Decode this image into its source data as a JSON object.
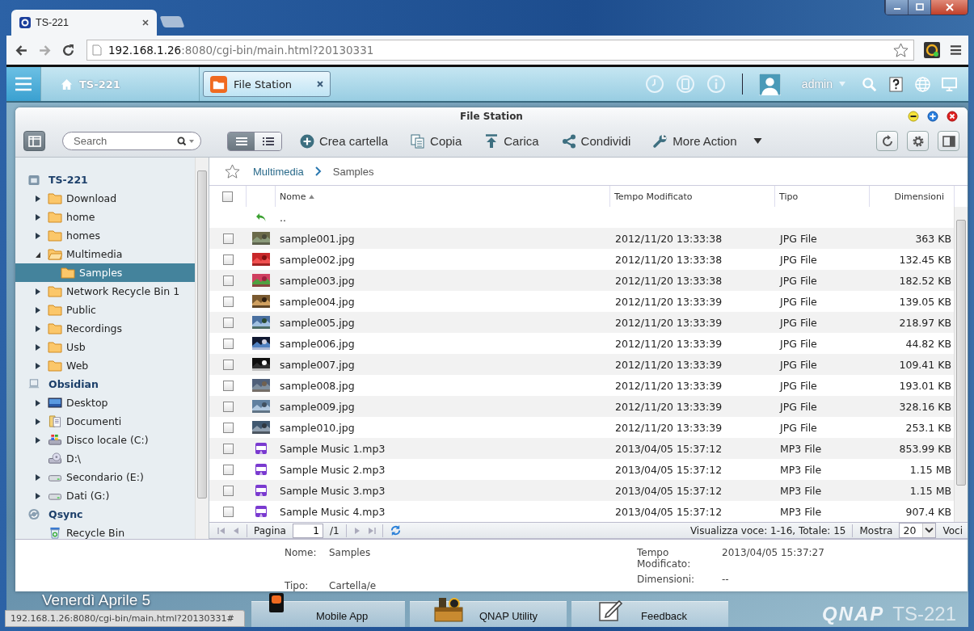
{
  "browser": {
    "tabs": [
      {
        "title": "TS-221",
        "selected": true
      }
    ],
    "url_host": "192.168.1.26",
    "url_rest": ":8080/cgi-bin/main.html?20130331"
  },
  "topbar": {
    "home_label": "TS-221",
    "app_tab": "File Station",
    "user": "admin"
  },
  "window": {
    "title": "File Station"
  },
  "toolbar": {
    "search_placeholder": "Search",
    "view_modes": [
      {
        "kind": "details",
        "selected": true
      },
      {
        "kind": "list",
        "selected": false
      }
    ],
    "actions": [
      {
        "label": "Crea cartella",
        "kind": "create"
      },
      {
        "label": "Copia",
        "kind": "copy"
      },
      {
        "label": "Carica",
        "kind": "upload"
      },
      {
        "label": "Condividi",
        "kind": "share"
      },
      {
        "label": "More Action",
        "kind": "more"
      }
    ]
  },
  "sidebar": {
    "tree": [
      {
        "label": "TS-221",
        "kind": "nas",
        "selected": false,
        "children": [
          {
            "label": "Download",
            "kind": "folder",
            "expanded": false,
            "selected": false
          },
          {
            "label": "home",
            "kind": "folder",
            "expanded": false,
            "selected": false
          },
          {
            "label": "homes",
            "kind": "folder",
            "expanded": false,
            "selected": false
          },
          {
            "label": "Multimedia",
            "kind": "folder",
            "expanded": true,
            "selected": false,
            "children": [
              {
                "label": "Samples",
                "kind": "folder",
                "selected": true
              }
            ]
          },
          {
            "label": "Network Recycle Bin 1",
            "kind": "folder",
            "expanded": false,
            "selected": false
          },
          {
            "label": "Public",
            "kind": "folder",
            "expanded": false,
            "selected": false
          },
          {
            "label": "Recordings",
            "kind": "folder",
            "expanded": false,
            "selected": false
          },
          {
            "label": "Usb",
            "kind": "folder",
            "expanded": false,
            "selected": false
          },
          {
            "label": "Web",
            "kind": "folder",
            "expanded": false,
            "selected": false
          }
        ]
      },
      {
        "label": "Obsidian",
        "kind": "computer",
        "selected": false,
        "children": [
          {
            "label": "Desktop",
            "kind": "desktop",
            "expanded": false,
            "selected": false
          },
          {
            "label": "Documenti",
            "kind": "documents",
            "expanded": false,
            "selected": false
          },
          {
            "label": "Disco locale (C:)",
            "kind": "system-drive",
            "expanded": false,
            "selected": false
          },
          {
            "label": "D:\\",
            "kind": "optical-drive",
            "selected": false
          },
          {
            "label": "Secondario (E:)",
            "kind": "drive",
            "expanded": false,
            "selected": false
          },
          {
            "label": "Dati (G:)",
            "kind": "drive",
            "expanded": false,
            "selected": false
          }
        ]
      },
      {
        "label": "Qsync",
        "kind": "sync",
        "selected": false,
        "children": [
          {
            "label": "Recycle Bin",
            "kind": "recycle",
            "selected": false
          }
        ]
      }
    ]
  },
  "breadcrumb": {
    "starred": false,
    "items": [
      "Multimedia",
      "Samples"
    ]
  },
  "table": {
    "all_checked": false,
    "columns": [
      {
        "label": "Nome",
        "sorted": true
      },
      {
        "label": "Tempo Modificato",
        "sorted": false
      },
      {
        "label": "Tipo",
        "sorted": false
      },
      {
        "label": "Dimensioni",
        "sorted": false
      }
    ],
    "parent_row": "..",
    "rows": [
      {
        "name": "sample001.jpg",
        "modified": "2012/11/20 13:33:38",
        "type": "JPG File",
        "size": "363 KB",
        "checked": false
      },
      {
        "name": "sample002.jpg",
        "modified": "2012/11/20 13:33:38",
        "type": "JPG File",
        "size": "132.45 KB",
        "checked": false
      },
      {
        "name": "sample003.jpg",
        "modified": "2012/11/20 13:33:38",
        "type": "JPG File",
        "size": "182.52 KB",
        "checked": false
      },
      {
        "name": "sample004.jpg",
        "modified": "2012/11/20 13:33:39",
        "type": "JPG File",
        "size": "139.05 KB",
        "checked": false
      },
      {
        "name": "sample005.jpg",
        "modified": "2012/11/20 13:33:39",
        "type": "JPG File",
        "size": "218.97 KB",
        "checked": false
      },
      {
        "name": "sample006.jpg",
        "modified": "2012/11/20 13:33:39",
        "type": "JPG File",
        "size": "44.82 KB",
        "checked": false
      },
      {
        "name": "sample007.jpg",
        "modified": "2012/11/20 13:33:39",
        "type": "JPG File",
        "size": "109.41 KB",
        "checked": false
      },
      {
        "name": "sample008.jpg",
        "modified": "2012/11/20 13:33:39",
        "type": "JPG File",
        "size": "193.01 KB",
        "checked": false
      },
      {
        "name": "sample009.jpg",
        "modified": "2012/11/20 13:33:39",
        "type": "JPG File",
        "size": "328.16 KB",
        "checked": false
      },
      {
        "name": "sample010.jpg",
        "modified": "2012/11/20 13:33:39",
        "type": "JPG File",
        "size": "253.1 KB",
        "checked": false
      },
      {
        "name": "Sample Music 1.mp3",
        "modified": "2013/04/05 15:37:12",
        "type": "MP3 File",
        "size": "853.99 KB",
        "kind": "audio",
        "checked": false
      },
      {
        "name": "Sample Music 2.mp3",
        "modified": "2013/04/05 15:37:12",
        "type": "MP3 File",
        "size": "1.15 MB",
        "kind": "audio",
        "checked": false
      },
      {
        "name": "Sample Music 3.mp3",
        "modified": "2013/04/05 15:37:12",
        "type": "MP3 File",
        "size": "1.15 MB",
        "kind": "audio",
        "checked": false
      },
      {
        "name": "Sample Music 4.mp3",
        "modified": "2013/04/05 15:37:12",
        "type": "MP3 File",
        "size": "907.4 KB",
        "kind": "audio",
        "checked": false
      }
    ]
  },
  "pagination": {
    "page_label": "Pagina",
    "page": "1",
    "of": "/1",
    "summary": "Visualizza voce: 1-16, Totale: 15",
    "show_label": "Mostra",
    "per_page": "20",
    "unit": "Voci"
  },
  "details": [
    {
      "label": "Nome:",
      "value": "Samples"
    },
    {
      "label": "Tipo:",
      "value": "Cartella/e"
    },
    {
      "label": "Tempo Modificato:",
      "value": "2013/04/05 15:37:27"
    },
    {
      "label": "Dimensioni:",
      "value": "--"
    }
  ],
  "desktop": {
    "date": "Venerdì  Aprile 5",
    "dock": [
      {
        "label": "Mobile App",
        "kind": "mobile"
      },
      {
        "label": "QNAP Utility",
        "kind": "utility"
      },
      {
        "label": "Feedback",
        "kind": "feedback"
      }
    ],
    "brand": "QNAP",
    "model": "TS-221"
  },
  "status_bubble": "192.168.1.26:8080/cgi-bin/main.html?20130331#"
}
